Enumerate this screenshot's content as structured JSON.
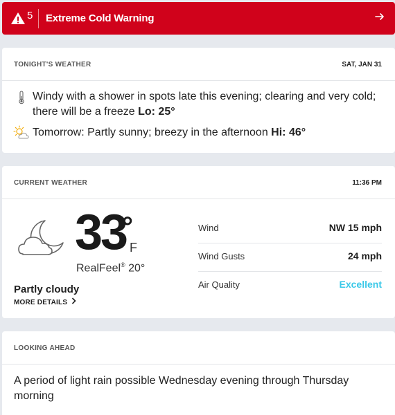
{
  "alert": {
    "count": "5",
    "title": "Extreme Cold Warning",
    "color": "#d0021b",
    "icons": [
      "warning-triangle-icon",
      "arrow-right-icon"
    ]
  },
  "tonight": {
    "header": "TONIGHT'S WEATHER",
    "date": "SAT, JAN 31",
    "night_text": "Windy with a shower in spots late this evening; clearing and very cold; there will be a freeze",
    "lo_label": "Lo: 25°",
    "tomorrow_text": "Tomorrow: Partly sunny; breezy in the afternoon",
    "hi_label": "Hi: 46°",
    "icons": [
      "thermometer-icon",
      "partly-sunny-icon"
    ]
  },
  "current": {
    "header": "CURRENT WEATHER",
    "time": "11:36 PM",
    "temp": "33",
    "deg": "°",
    "unit": "F",
    "realfeel_label": "RealFeel",
    "realfeel_value": "20°",
    "condition": "Partly cloudy",
    "more_details": "MORE DETAILS",
    "details": [
      {
        "label": "Wind",
        "value": "NW 15 mph"
      },
      {
        "label": "Wind Gusts",
        "value": "24 mph"
      },
      {
        "label": "Air Quality",
        "value": "Excellent"
      }
    ],
    "air_quality_color": "#3ac8e8",
    "icon": "cloud-moon-icon"
  },
  "ahead": {
    "header": "LOOKING AHEAD",
    "text": "A period of light rain possible Wednesday evening through Thursday morning"
  }
}
